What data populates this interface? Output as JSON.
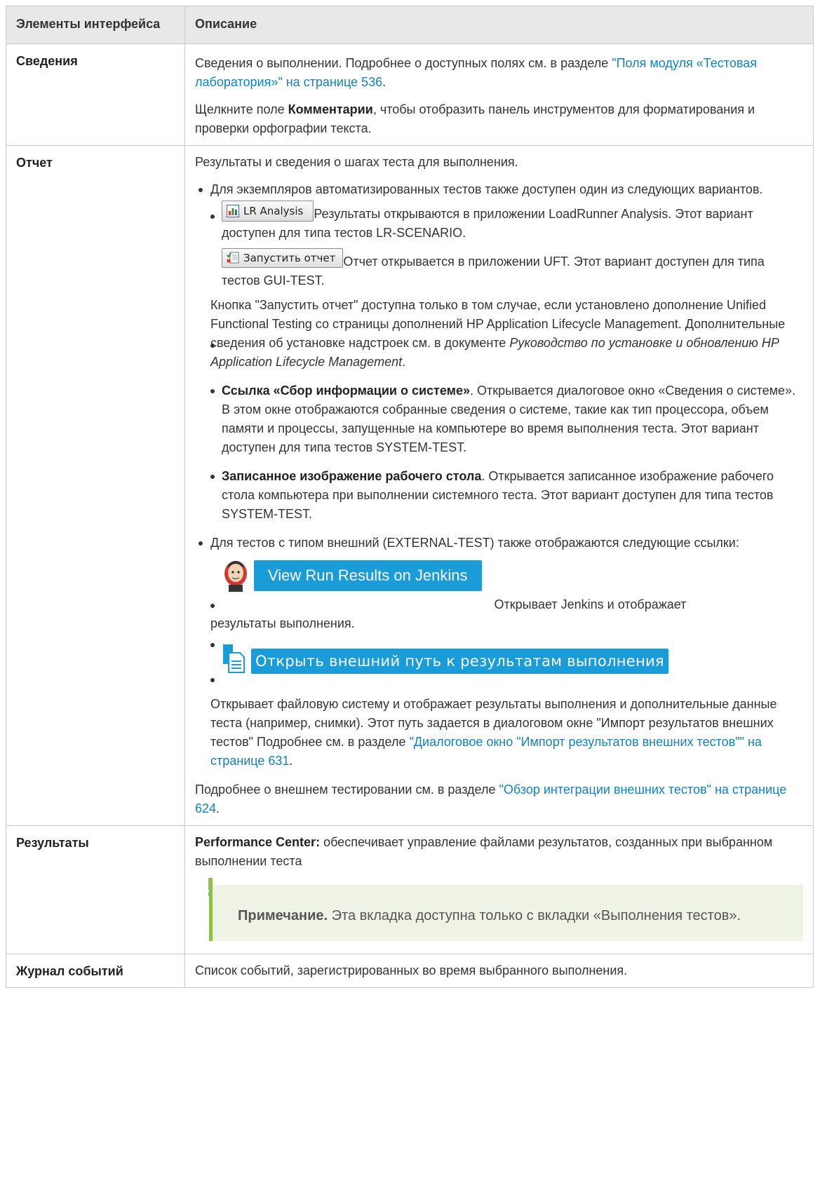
{
  "header": {
    "col1": "Элементы интерфейса",
    "col2": "Описание"
  },
  "rows": {
    "details": {
      "name": "Сведения",
      "p1_text": "Сведения о выполнении. Подробнее о доступных полях см. в разделе ",
      "p1_link": "\"Поля модуля «Тестовая лаборатория»\" на странице 536",
      "p1_end": ".",
      "p2_pre": "Щелкните поле ",
      "p2_bold": "Комментарии",
      "p2_post": ", чтобы отобразить панель инструментов для форматирования и проверки орфографии текста."
    },
    "report": {
      "name": "Отчет",
      "intro": "Результаты и сведения о шагах теста для выполнения.",
      "auto_intro": "Для экземпляров автоматизированных тестов также доступен один из следующих вариантов.",
      "lr_button": "LR Analysis",
      "lr_text": "Результаты открываются в приложении LoadRunner Analysis. Этот вариант доступен для типа тестов LR-SCENARIO.",
      "run_button": "Запустить отчет",
      "run_text": "Отчет открывается в приложении UFT. Этот вариант доступен для типа тестов GUI-TEST.",
      "run_note": "Кнопка \"Запустить отчет\" доступна только в том случае, если установлено дополнение Unified Functional Testing со страницы дополнений HP Application Lifecycle Management. Дополнительные сведения об установке надстроек см. в документе ",
      "run_note_italic": "Руководство по установке и обновлению HP Application Lifecycle Management",
      "run_note_end": ".",
      "sysinfo_bold": "Ссылка «Сбор информации о системе»",
      "sysinfo_text": ". Открывается диалоговое окно «Сведения о системе». В этом окне отображаются собранные сведения о системе, такие как тип процессора, объем памяти и процессы, запущенные на компьютере во время выполнения теста. Этот вариант доступен для типа тестов SYSTEM-TEST.",
      "desktop_bold": "Записанное изображение рабочего стола",
      "desktop_text": ". Открывается записанное изображение рабочего стола компьютера при выполнении системного теста. Этот вариант доступен для типа тестов SYSTEM-TEST.",
      "ext_intro": "Для тестов с типом внешний (EXTERNAL-TEST) также отображаются следующие ссылки:",
      "jenkins_button": "View Run Results on Jenkins",
      "jenkins_text": "Открывает Jenkins и отображает",
      "jenkins_text2": "результаты выполнения.",
      "extpath_button": "Открыть внешний путь к результатам выполнения",
      "extpath_text": "Открывает файловую систему и отображает результаты выполнения и дополнительные данные теста (например, снимки). Этот путь задается в диалоговом окне \"Импорт результатов внешних тестов\" Подробнее см. в разделе ",
      "extpath_link": "\"Диалоговое окно \"Импорт результатов внешних тестов\"\" на странице 631",
      "extpath_end": ".",
      "ext_more": "Подробнее о внешнем тестировании см. в разделе ",
      "ext_more_link": "\"Обзор интеграции внешних тестов\" на странице 624",
      "ext_more_end": "."
    },
    "results": {
      "name": "Результаты",
      "pc_bold": "Performance Center:",
      "pc_text": " обеспечивает управление файлами результатов, созданных при выбранном выполнении теста",
      "note_bold": "Примечание.",
      "note_text": " Эта вкладка доступна только с вкладки «Выполнения тестов»."
    },
    "eventlog": {
      "name": "Журнал событий",
      "text": "Список событий, зарегистрированных во время выбранного выполнения."
    }
  },
  "colors": {
    "link": "#0e82c8",
    "header_bg": "#e8e8e8",
    "note_bg": "#eef3e6",
    "note_bar": "#8cc04b",
    "button_blue": "#1a9cd8"
  }
}
